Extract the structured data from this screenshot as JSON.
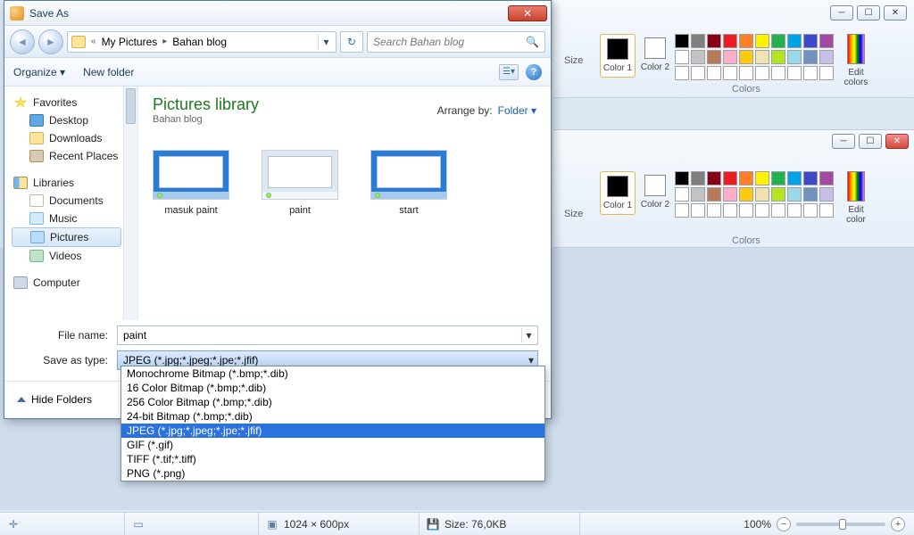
{
  "dialog": {
    "title": "Save As",
    "close_glyph": "✕",
    "breadcrumb": {
      "sep_left": "«",
      "part1": "My Pictures",
      "sep": "▸",
      "part2": "Bahan blog"
    },
    "search_placeholder": "Search Bahan blog",
    "toolbar": {
      "organize": "Organize ▾",
      "newfolder": "New folder"
    },
    "library": {
      "title": "Pictures library",
      "subtitle": "Bahan blog",
      "arrange_label": "Arrange by:",
      "arrange_value": "Folder ▾"
    },
    "thumbs": [
      {
        "caption": "masuk paint",
        "style": "win"
      },
      {
        "caption": "paint",
        "style": "win-light"
      },
      {
        "caption": "start",
        "style": "win"
      }
    ],
    "tree": {
      "favorites": "Favorites",
      "desktop": "Desktop",
      "downloads": "Downloads",
      "recent": "Recent Places",
      "libraries": "Libraries",
      "documents": "Documents",
      "music": "Music",
      "pictures": "Pictures",
      "videos": "Videos",
      "computer": "Computer"
    },
    "filename_label": "File name:",
    "filename_value": "paint",
    "saveastype_label": "Save as type:",
    "saveastype_value": "JPEG (*.jpg;*.jpeg;*.jpe;*.jfif)",
    "hide_folders": "Hide Folders",
    "type_options": [
      "Monochrome Bitmap (*.bmp;*.dib)",
      "16 Color Bitmap (*.bmp;*.dib)",
      "256 Color Bitmap (*.bmp;*.dib)",
      "24-bit Bitmap (*.bmp;*.dib)",
      "JPEG (*.jpg;*.jpeg;*.jpe;*.jfif)",
      "GIF (*.gif)",
      "TIFF (*.tif;*.tiff)",
      "PNG (*.png)"
    ],
    "type_selected_index": 4
  },
  "ribbon": {
    "size_label": "Size",
    "color1": "Color\n1",
    "color2": "Color\n2",
    "edit_colors": "Edit\ncolors",
    "colors_group": "Colors",
    "palette_row1": [
      "#000000",
      "#7f7f7f",
      "#880015",
      "#ed1c24",
      "#ff7f27",
      "#fff200",
      "#22b14c",
      "#00a2e8",
      "#3f48cc",
      "#a349a4"
    ],
    "palette_row2": [
      "#ffffff",
      "#c3c3c3",
      "#b97a57",
      "#ffaec9",
      "#ffc90e",
      "#efe4b0",
      "#b5e61d",
      "#99d9ea",
      "#7092be",
      "#c8bfe7"
    ],
    "palette_row3": [
      "#ffffff",
      "#ffffff",
      "#ffffff",
      "#ffffff",
      "#ffffff",
      "#ffffff",
      "#ffffff",
      "#ffffff",
      "#ffffff",
      "#ffffff"
    ]
  },
  "status": {
    "dimensions": "1024 × 600px",
    "filesize": "Size: 76,0KB",
    "zoom": "100%"
  },
  "ribbon2": {
    "edit_colors_short": "Edit\ncolor"
  }
}
